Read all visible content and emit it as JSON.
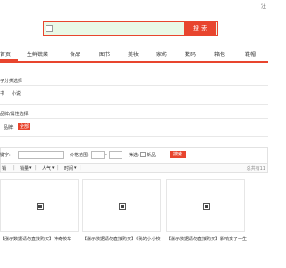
{
  "header": {
    "top_right_link": "注"
  },
  "search": {
    "button_label": "搜 索"
  },
  "nav": {
    "items": [
      "首页",
      "生鲜蔬菜",
      "食品",
      "图书",
      "美妆",
      "家纺",
      "数码",
      "箱包",
      "鞋帽"
    ]
  },
  "category": {
    "title": "子分类选择",
    "options": [
      "书",
      "小说"
    ]
  },
  "brand": {
    "title": "品牌/属性选择",
    "label": "品牌:",
    "selected": "全部"
  },
  "filter": {
    "keyword_label": "键字:",
    "price_label": "价格范围:",
    "range_dash": "-",
    "filter_label": "筛选:",
    "new_label": "新品",
    "button_label": "搜索"
  },
  "sort": {
    "options": [
      "销",
      "销量",
      "人气",
      "时间"
    ],
    "arrow": "▾",
    "total_text": "总共有11"
  },
  "products": [
    {
      "title": "【涨示数据请勿直接购买】神奇校车"
    },
    {
      "title": "【涨示数据请勿直接购买】《我的小小校"
    },
    {
      "title": "【涨示数据请勿直接购买】影响孩子一生"
    }
  ],
  "colors": {
    "accent": "#e8452e",
    "search_bg": "#e9f9e7"
  }
}
